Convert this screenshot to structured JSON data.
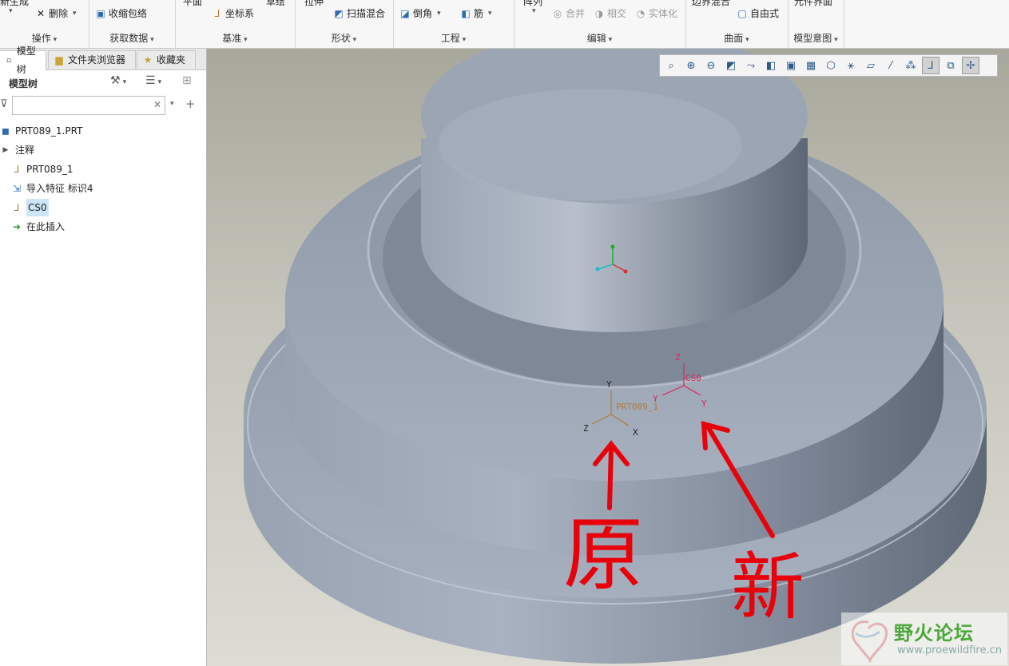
{
  "ribbon": {
    "groups": [
      {
        "label": "操作"
      },
      {
        "label": "获取数据"
      },
      {
        "label": "基准"
      },
      {
        "label": "形状"
      },
      {
        "label": "工程"
      },
      {
        "label": "编辑"
      },
      {
        "label": "曲面"
      },
      {
        "label": "模型意图"
      }
    ],
    "cut_labels": {
      "regenerate": "新生成",
      "plane": "平面",
      "sketch": "草绘",
      "extrude": "拉伸",
      "pattern": "阵列",
      "boundary_blend": "边界混合",
      "component_interface": "元件界面"
    },
    "commands": {
      "delete": "删除",
      "shrinkwrap": "收缩包络",
      "coordinate_system": "坐标系",
      "sweep_blend": "扫描混合",
      "chamfer": "倒角",
      "rib": "筋",
      "merge": "合并",
      "intersect": "相交",
      "solidify": "实体化",
      "freestyle": "自由式"
    }
  },
  "panel": {
    "tabs": [
      {
        "label": "模型树"
      },
      {
        "label": "文件夹浏览器"
      },
      {
        "label": "收藏夹"
      }
    ],
    "tree_title": "模型树",
    "filter": {
      "value": "",
      "placeholder": ""
    },
    "tree": [
      {
        "label": "PRT089_1.PRT",
        "icon": "part-icon"
      },
      {
        "label": "注释",
        "icon": "expand-arrow-icon"
      },
      {
        "label": "PRT089_1",
        "icon": "csys-icon"
      },
      {
        "label": "导入特征 标识4",
        "icon": "import-feature-icon"
      },
      {
        "label": "CS0",
        "icon": "csys-icon",
        "selected": true
      },
      {
        "label": "在此插入",
        "icon": "insert-here-icon"
      }
    ]
  },
  "viewport": {
    "csys_original": {
      "name": "PRT089_1",
      "x_label": "X",
      "y_label": "Y",
      "z_label": "Z",
      "color": "#b07a3a"
    },
    "csys_new": {
      "name": "CS0",
      "x_label": "Y",
      "y_label": "Y",
      "z_label": "Z",
      "color": "#d6285c"
    },
    "annotations": {
      "original": "原",
      "new": "新",
      "color": "#e8000a"
    },
    "model_color": "#8f99a8"
  },
  "watermark": {
    "name": "野火论坛",
    "url": "www.proewildfire.cn"
  }
}
